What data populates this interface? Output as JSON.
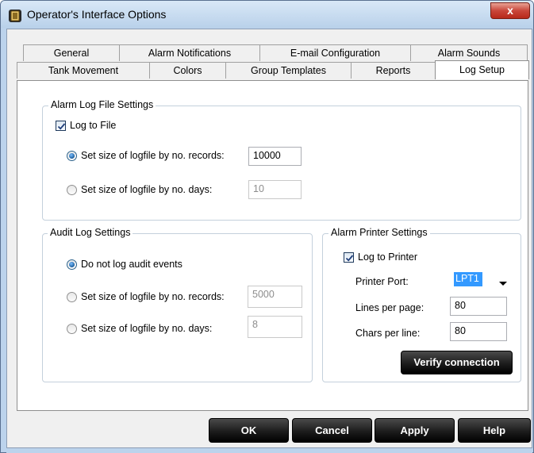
{
  "window": {
    "title": "Operator's Interface Options",
    "close_glyph": "x",
    "icon": "app-icon"
  },
  "tabs": {
    "row_back": [
      {
        "label": "General"
      },
      {
        "label": "Alarm Notifications"
      },
      {
        "label": "E-mail Configuration"
      },
      {
        "label": "Alarm Sounds"
      }
    ],
    "row_front": [
      {
        "label": "Tank Movement"
      },
      {
        "label": "Colors"
      },
      {
        "label": "Group Templates"
      },
      {
        "label": "Reports"
      },
      {
        "label": "Log Setup",
        "selected": true
      }
    ]
  },
  "alarm_log": {
    "legend": "Alarm Log File Settings",
    "log_to_file_label": "Log to File",
    "log_to_file_checked": true,
    "by_records_label": "Set size of logfile by no. records:",
    "by_records_value": "10000",
    "by_records_selected": true,
    "by_days_label": "Set size of logfile by no. days:",
    "by_days_value": "10"
  },
  "audit_log": {
    "legend": "Audit Log Settings",
    "do_not_log_label": "Do not log audit events",
    "do_not_log_selected": true,
    "by_records_label": "Set size of logfile by no. records:",
    "by_records_value": "5000",
    "by_days_label": "Set size of logfile by no. days:",
    "by_days_value": "8"
  },
  "printer": {
    "legend": "Alarm Printer Settings",
    "log_to_printer_label": "Log to Printer",
    "log_to_printer_checked": true,
    "port_label": "Printer Port:",
    "port_value": "LPT1",
    "lines_label": "Lines per page:",
    "lines_value": "80",
    "chars_label": "Chars per line:",
    "chars_value": "80",
    "verify_label": "Verify connection"
  },
  "buttons": {
    "ok": "OK",
    "cancel": "Cancel",
    "apply": "Apply",
    "help": "Help"
  },
  "colors": {
    "selection_highlight": "#3399ff",
    "titlebar": "#b9d1ea",
    "close_button": "#c9463a"
  }
}
